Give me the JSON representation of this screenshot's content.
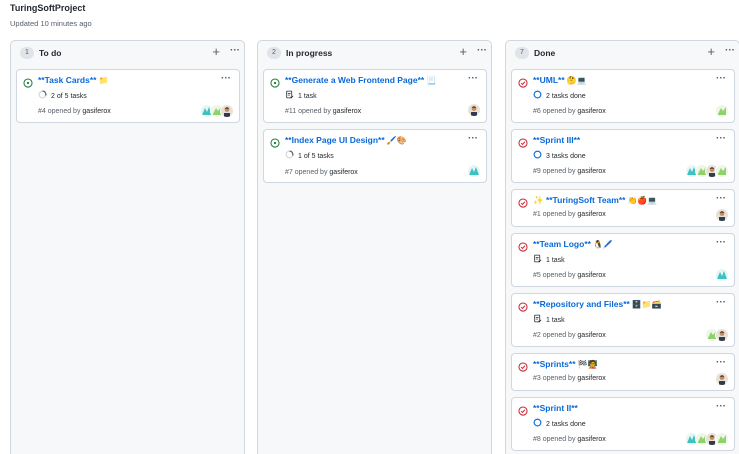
{
  "project": {
    "title": "TuringSoftProject",
    "updated": "Updated 10 minutes ago"
  },
  "colors": {
    "open": "#1a7f37",
    "closed": "#cf222e",
    "link": "#0969da",
    "progress": "#0969da"
  },
  "columns": [
    {
      "count": "1",
      "title": "To do",
      "cards": [
        {
          "status": "open",
          "title": "**Task Cards**",
          "emoji": "📁",
          "meta_icon": "progress-ring-icon",
          "meta": "2 of 5 tasks",
          "number": "#4",
          "opened_by": "opened by",
          "author": "gasiferox",
          "avatars": [
            "avatar-teal",
            "avatar-green",
            "avatar-person"
          ]
        }
      ]
    },
    {
      "count": "2",
      "title": "In progress",
      "cards": [
        {
          "status": "open",
          "title": "**Generate a Web Frontend Page**",
          "emoji": "📃",
          "meta_icon": "task-list-icon",
          "meta": "1 task",
          "number": "#11",
          "opened_by": "opened by",
          "author": "gasiferox",
          "avatars": [
            "avatar-person"
          ]
        },
        {
          "status": "open",
          "title": "**Index Page UI Design**",
          "emoji": "🖌️🎨",
          "meta_icon": "progress-ring-icon",
          "meta": "1 of 5 tasks",
          "number": "#7",
          "opened_by": "opened by",
          "author": "gasiferox",
          "avatars": [
            "avatar-teal"
          ]
        }
      ]
    },
    {
      "count": "7",
      "title": "Done",
      "cards": [
        {
          "status": "closed",
          "title": "**UML**",
          "emoji": "🤔💻",
          "meta_icon": "done-circle-icon",
          "meta": "2 tasks done",
          "number": "#6",
          "opened_by": "opened by",
          "author": "gasiferox",
          "avatars": [
            "avatar-green"
          ]
        },
        {
          "status": "closed",
          "title": "**Sprint III**",
          "emoji": "",
          "meta_icon": "done-circle-icon",
          "meta": "3 tasks done",
          "number": "#9",
          "opened_by": "opened by",
          "author": "gasiferox",
          "avatars": [
            "avatar-teal",
            "avatar-green",
            "avatar-person",
            "avatar-green"
          ]
        },
        {
          "status": "closed",
          "title": "✨ **TuringSoft Team**",
          "emoji": "👏🍎💻",
          "meta_icon": "",
          "meta": "",
          "number": "#1",
          "opened_by": "opened by",
          "author": "gasiferox",
          "avatars": [
            "avatar-person"
          ]
        },
        {
          "status": "closed",
          "title": "**Team Logo**",
          "emoji": "🐧🖊️",
          "meta_icon": "task-list-icon",
          "meta": "1 task",
          "number": "#5",
          "opened_by": "opened by",
          "author": "gasiferox",
          "avatars": [
            "avatar-teal"
          ]
        },
        {
          "status": "closed",
          "title": "**Repository and Files**",
          "emoji": "🗄️📁🗃️",
          "meta_icon": "task-list-icon",
          "meta": "1 task",
          "number": "#2",
          "opened_by": "opened by",
          "author": "gasiferox",
          "avatars": [
            "avatar-green",
            "avatar-person"
          ]
        },
        {
          "status": "closed",
          "title": "**Sprints**",
          "emoji": "🏁🧑‍🏫",
          "meta_icon": "",
          "meta": "",
          "number": "#3",
          "opened_by": "opened by",
          "author": "gasiferox",
          "avatars": [
            "avatar-person"
          ]
        },
        {
          "status": "closed",
          "title": "**Sprint II**",
          "emoji": "",
          "meta_icon": "done-circle-icon",
          "meta": "2 tasks done",
          "number": "#8",
          "opened_by": "opened by",
          "author": "gasiferox",
          "avatars": [
            "avatar-teal",
            "avatar-green",
            "avatar-person",
            "avatar-green"
          ]
        }
      ]
    }
  ]
}
